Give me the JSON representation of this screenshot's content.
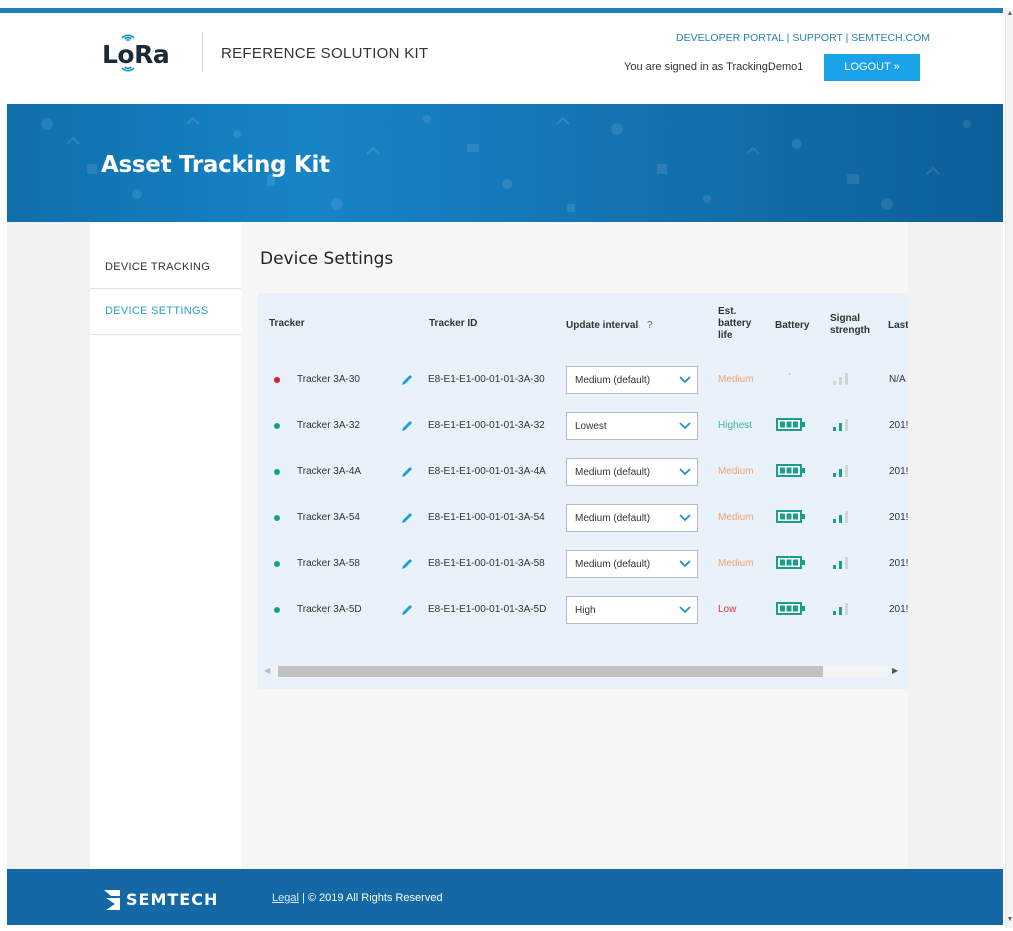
{
  "header": {
    "logo_text": "LoRa",
    "kit_title": "REFERENCE SOLUTION KIT",
    "links": [
      "DEVELOPER PORTAL",
      "SUPPORT",
      "SEMTECH.COM"
    ],
    "link_separator": " | ",
    "signed_in_text": "You are signed in as TrackingDemo1",
    "logout_label": "LOGOUT »"
  },
  "banner": {
    "title": "Asset Tracking Kit"
  },
  "sidebar": {
    "items": [
      {
        "label": "DEVICE TRACKING",
        "active": false
      },
      {
        "label": "DEVICE SETTINGS",
        "active": true
      }
    ]
  },
  "main": {
    "title": "Device Settings",
    "columns": {
      "tracker": "Tracker",
      "tracker_id": "Tracker ID",
      "update_interval": "Update interval",
      "help": "?",
      "est_battery_1": "Est.",
      "est_battery_2": "battery",
      "est_battery_3": "life",
      "battery": "Battery",
      "signal_1": "Signal",
      "signal_2": "strength",
      "last": "Last"
    },
    "rows": [
      {
        "name": "Tracker 3A-30",
        "id": "E8-E1-E1-00-01-01-3A-30",
        "interval": "Medium (default)",
        "battery_life": "Medium",
        "battery_life_color": "#f0a56a",
        "battery": "-",
        "last": "N/A",
        "status_color": "#d6202a",
        "online": false
      },
      {
        "name": "Tracker 3A-32",
        "id": "E8-E1-E1-00-01-01-3A-32",
        "interval": "Lowest",
        "battery_life": "Highest",
        "battery_life_color": "#3bb7a8",
        "battery": "full",
        "last": "201!",
        "status_color": "#1a9e8d",
        "online": true
      },
      {
        "name": "Tracker 3A-4A",
        "id": "E8-E1-E1-00-01-01-3A-4A",
        "interval": "Medium (default)",
        "battery_life": "Medium",
        "battery_life_color": "#f0a56a",
        "battery": "full",
        "last": "201!",
        "status_color": "#1a9e8d",
        "online": true
      },
      {
        "name": "Tracker 3A-54",
        "id": "E8-E1-E1-00-01-01-3A-54",
        "interval": "Medium (default)",
        "battery_life": "Medium",
        "battery_life_color": "#f0a56a",
        "battery": "full",
        "last": "201!",
        "status_color": "#1a9e8d",
        "online": true
      },
      {
        "name": "Tracker 3A-58",
        "id": "E8-E1-E1-00-01-01-3A-58",
        "interval": "Medium (default)",
        "battery_life": "Medium",
        "battery_life_color": "#f0a56a",
        "battery": "full",
        "last": "201!",
        "status_color": "#1a9e8d",
        "online": true
      },
      {
        "name": "Tracker 3A-5D",
        "id": "E8-E1-E1-00-01-01-3A-5D",
        "interval": "High",
        "battery_life": "Low",
        "battery_life_color": "#e0303a",
        "battery": "full",
        "last": "201!",
        "status_color": "#1a9e8d",
        "online": true
      }
    ]
  },
  "footer": {
    "brand": "SEMTECH",
    "legal_label": "Legal",
    "copyright": " | © 2019 All Rights Reserved"
  },
  "colors": {
    "accent": "#1aa3e8",
    "banner": "#1784c6",
    "footer": "#1368a5",
    "online": "#1a9e8d",
    "offline": "#d6202a"
  }
}
